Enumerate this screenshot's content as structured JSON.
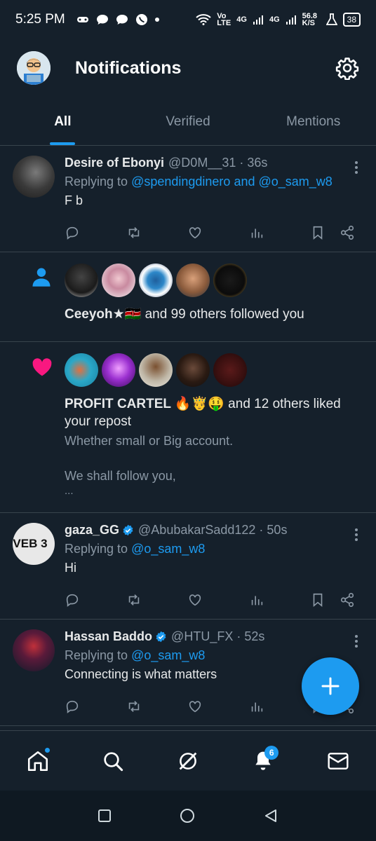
{
  "status": {
    "time": "5:25 PM",
    "net1": "Vo LTE",
    "net2": "4G",
    "net3": "4G",
    "speed": "56.8 K/S",
    "battery": "38"
  },
  "header": {
    "title": "Notifications"
  },
  "tabs": [
    {
      "label": "All",
      "active": true
    },
    {
      "label": "Verified"
    },
    {
      "label": "Mentions"
    }
  ],
  "feed": {
    "t1": {
      "name": "Desire of Ebonyi",
      "meta": "@D0M__31 · 36s",
      "reply_prefix": "Replying to ",
      "mention1": "@spendingdinero",
      "joiner": " and ",
      "mention2": "@o_sam_w8",
      "text": "F b"
    },
    "follow": {
      "actor": "Ceeyoh★🇰🇪",
      "rest": " and 99 others followed you"
    },
    "like": {
      "actor": "PROFIT CARTEL 🔥🤴🤑",
      "rest": " and 12 others liked your repost",
      "line1": "Whether small or Big account.",
      "line2": "We shall follow you,",
      "line3": "..."
    },
    "t2": {
      "name": "gaza_GG",
      "meta": "@AbubakarSadd122 · 50s",
      "reply_prefix": "Replying to ",
      "mention1": "@o_sam_w8",
      "text": "Hi",
      "avatar_text": "VEB 3"
    },
    "t3": {
      "name": "Hassan Baddo",
      "meta": "@HTU_FX · 52s",
      "reply_prefix": "Replying to ",
      "mention1": "@o_sam_w8",
      "text": "Connecting is what matters"
    }
  },
  "nav": {
    "notif_count": "6"
  },
  "colors": {
    "accent": "#1d9bf0",
    "bg": "#15202b",
    "like": "#f91880",
    "muted": "#8b98a5"
  }
}
